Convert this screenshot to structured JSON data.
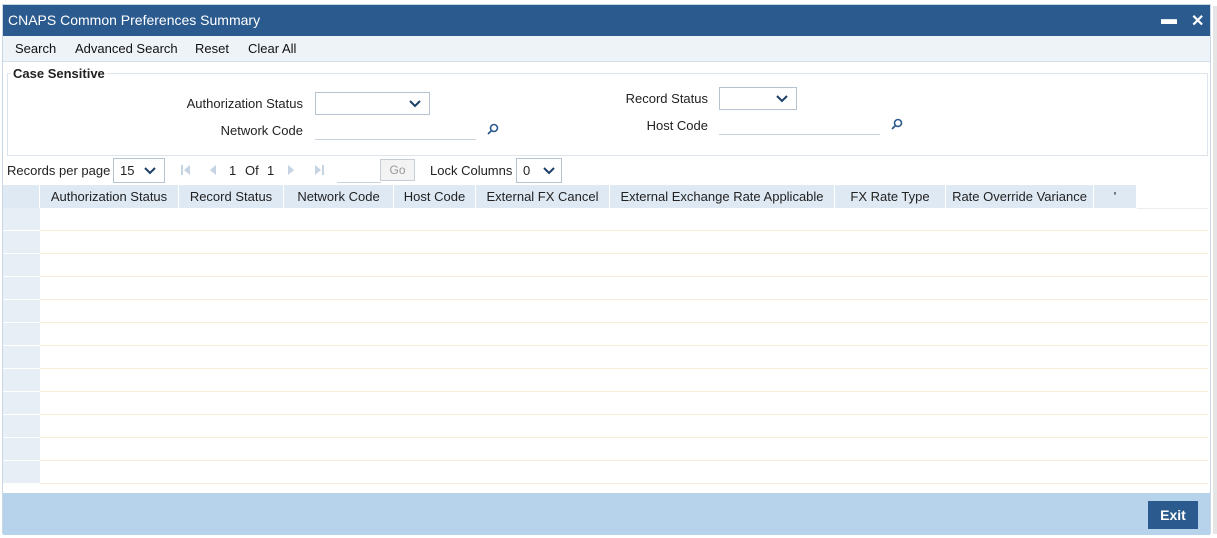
{
  "window": {
    "title": "CNAPS Common Preferences Summary",
    "minimize": "▬",
    "close": "✕"
  },
  "toolbar": {
    "search": "Search",
    "advanced_search": "Advanced Search",
    "reset": "Reset",
    "clear_all": "Clear All"
  },
  "criteria": {
    "section_title": "Case Sensitive",
    "authorization_status_label": "Authorization Status",
    "authorization_status_value": "",
    "record_status_label": "Record Status",
    "record_status_value": "",
    "network_code_label": "Network Code",
    "network_code_value": "",
    "host_code_label": "Host Code",
    "host_code_value": ""
  },
  "pager": {
    "records_per_page_label": "Records per page",
    "records_per_page_value": "15",
    "current_page": "1",
    "of_label": "Of",
    "total_pages": "1",
    "go_label": "Go",
    "lock_columns_label": "Lock Columns",
    "lock_columns_value": "0"
  },
  "grid": {
    "columns": [
      "Authorization Status",
      "Record Status",
      "Network Code",
      "Host Code",
      "External FX Cancel",
      "External Exchange Rate Applicable",
      "FX Rate Type",
      "Rate Override Variance"
    ],
    "trailing_marker": "'",
    "row_count": 12
  },
  "footer": {
    "exit": "Exit"
  },
  "colors": {
    "titlebar": "#2a5a8e",
    "header": "#dfe9f4",
    "footer": "#b6d3eb",
    "exit_button": "#2a5a8e"
  },
  "icons": [
    "minimize-icon",
    "close-icon",
    "chevron-down-icon",
    "search-lens-icon",
    "first-page-icon",
    "prev-page-icon",
    "next-page-icon",
    "last-page-icon"
  ]
}
